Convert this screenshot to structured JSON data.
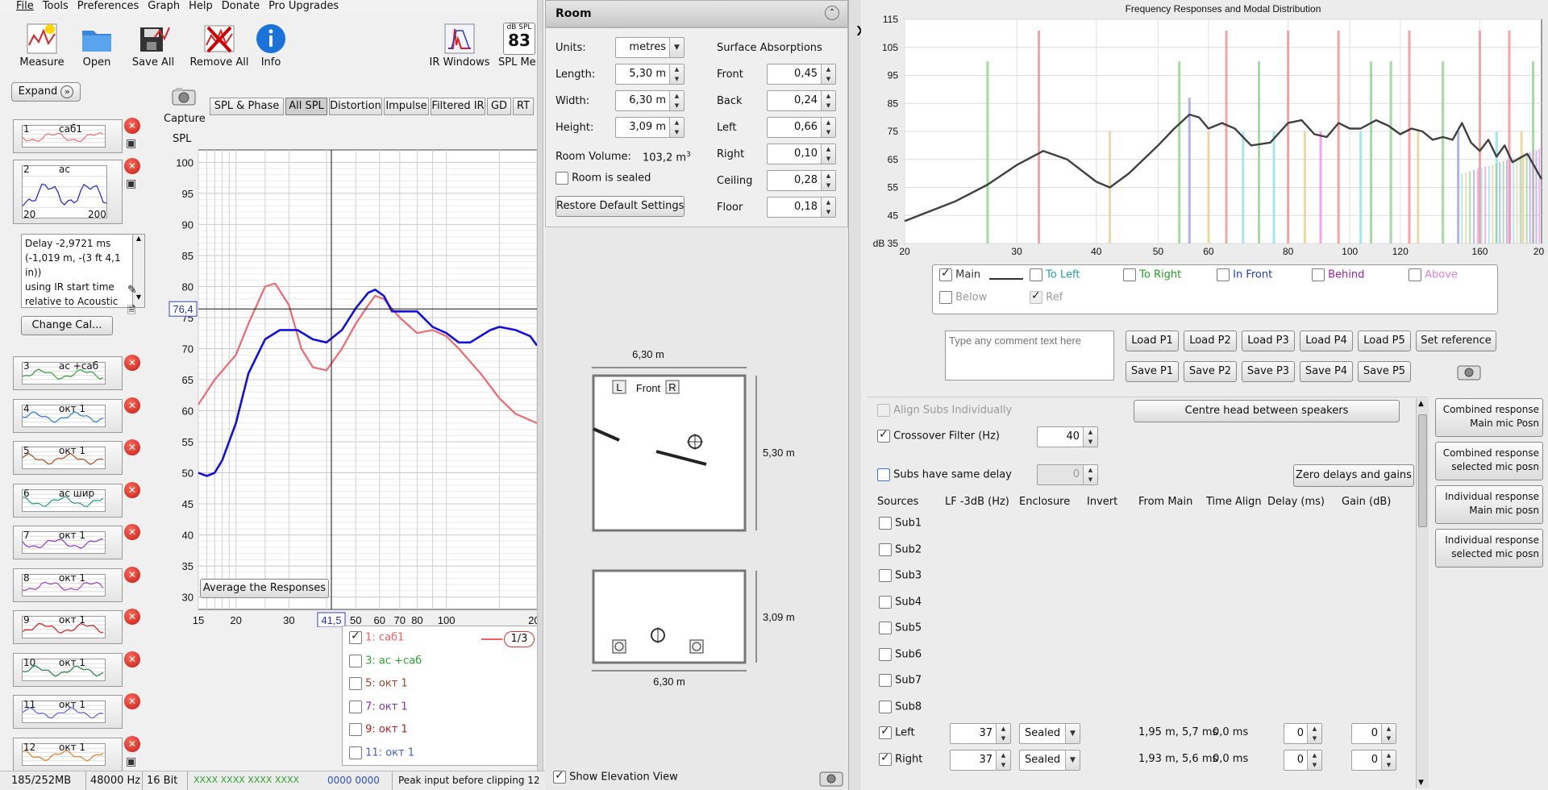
{
  "menu": [
    "File",
    "Tools",
    "Preferences",
    "Graph",
    "Help",
    "Donate",
    "Pro Upgrades"
  ],
  "toolbar": {
    "measure": "Measure",
    "open": "Open",
    "save_all": "Save All",
    "remove_all": "Remove All",
    "info": "Info",
    "ir_windows": "IR Windows",
    "spl_meter": "SPL Me",
    "spl_unit": "dB SPL",
    "spl_value": "83"
  },
  "sidebar": {
    "expand": "Expand",
    "items": [
      {
        "num": "1",
        "name": "саб1"
      },
      {
        "num": "2",
        "name": "ac"
      },
      {
        "num": "3",
        "name": "ac +саб"
      },
      {
        "num": "4",
        "name": "окт 1"
      },
      {
        "num": "5",
        "name": "окт 1"
      },
      {
        "num": "6",
        "name": "ac шир"
      },
      {
        "num": "7",
        "name": "окт 1"
      },
      {
        "num": "8",
        "name": "окт 1"
      },
      {
        "num": "9",
        "name": "окт 1"
      },
      {
        "num": "10",
        "name": "окт 1"
      },
      {
        "num": "11",
        "name": "окт 1"
      },
      {
        "num": "12",
        "name": "окт 1"
      }
    ],
    "thumb_axis_min": "20",
    "thumb_axis_max": "200",
    "notes": [
      "Delay -2,9721 ms",
      "(-1,019 m, -(3 ft 4,1",
      "in))",
      "using IR start time",
      "relative to Acoustic"
    ],
    "change_cal": "Change Cal..."
  },
  "graph": {
    "capture": "Capture",
    "tabs": [
      "SPL & Phase",
      "All SPL",
      "Distortion",
      "Impulse",
      "Filtered IR",
      "GD",
      "RT"
    ],
    "ylabel": "SPL",
    "cursor_y": "76,4",
    "cursor_x": "41,5",
    "average": "Average the Responses",
    "legend": [
      {
        "label": "1: саб1",
        "color": "#f06060",
        "checked": true
      },
      {
        "label": "3: ac +саб",
        "color": "#30a030",
        "checked": false
      },
      {
        "label": "5: окт 1",
        "color": "#b04020",
        "checked": false
      },
      {
        "label": "7: окт 1",
        "color": "#8030c0",
        "checked": false
      },
      {
        "label": "9: окт 1",
        "color": "#c02020",
        "checked": false
      },
      {
        "label": "11: окт 1",
        "color": "#4060d0",
        "checked": false
      }
    ],
    "smoothing": "1/3"
  },
  "chart_data": [
    {
      "type": "line",
      "ylabel": "SPL",
      "ylim": [
        28,
        102
      ],
      "x_ticks": [
        "15",
        "20",
        "30",
        "50",
        "60",
        "70",
        "80",
        "100",
        "200"
      ],
      "y_ticks": [
        "100",
        "95",
        "90",
        "85",
        "80",
        "75",
        "70",
        "65",
        "60",
        "55",
        "50",
        "45",
        "40",
        "35",
        "30"
      ],
      "series": [
        {
          "color": "#f06870",
          "points": [
            [
              15,
              61
            ],
            [
              17,
              65
            ],
            [
              20,
              69
            ],
            [
              22,
              74
            ],
            [
              25,
              80
            ],
            [
              27,
              80.5
            ],
            [
              30,
              77
            ],
            [
              33,
              70
            ],
            [
              36,
              67
            ],
            [
              40,
              66.5
            ],
            [
              45,
              70
            ],
            [
              50,
              74
            ],
            [
              55,
              77
            ],
            [
              58,
              78.5
            ],
            [
              62,
              78
            ],
            [
              70,
              75
            ],
            [
              80,
              72.5
            ],
            [
              90,
              73
            ],
            [
              100,
              72
            ],
            [
              110,
              70
            ],
            [
              130,
              66
            ],
            [
              150,
              62
            ],
            [
              170,
              59.5
            ],
            [
              200,
              58
            ]
          ]
        },
        {
          "color": "#1010e0",
          "points": [
            [
              15,
              50
            ],
            [
              16,
              49.5
            ],
            [
              17,
              50
            ],
            [
              18,
              52
            ],
            [
              20,
              58
            ],
            [
              22,
              66
            ],
            [
              25,
              71.5
            ],
            [
              28,
              73
            ],
            [
              32,
              73
            ],
            [
              36,
              71.5
            ],
            [
              40,
              71
            ],
            [
              45,
              73
            ],
            [
              50,
              76.5
            ],
            [
              55,
              79
            ],
            [
              58,
              79.5
            ],
            [
              62,
              78.5
            ],
            [
              66,
              76
            ],
            [
              70,
              76
            ],
            [
              80,
              76
            ],
            [
              90,
              73.5
            ],
            [
              100,
              72.5
            ],
            [
              110,
              71
            ],
            [
              120,
              71
            ],
            [
              140,
              73
            ],
            [
              150,
              73.5
            ],
            [
              170,
              73
            ],
            [
              190,
              72
            ],
            [
              200,
              70.5
            ]
          ]
        }
      ]
    },
    {
      "type": "line",
      "title": "Frequency Responses and Modal Distribution",
      "ylabel": "dB",
      "ylim": [
        35,
        115
      ],
      "xlim": [
        20,
        200
      ],
      "x_ticks": [
        "20",
        "30",
        "40",
        "50",
        "60",
        "80",
        "100",
        "120",
        "160",
        "20"
      ],
      "y_ticks": [
        "115",
        "105",
        "95",
        "85",
        "75",
        "65",
        "55",
        "45",
        "35"
      ],
      "series": [
        {
          "name": "Main",
          "color": "#404040",
          "points": [
            [
              20,
              43
            ],
            [
              24,
              50
            ],
            [
              27,
              56
            ],
            [
              30,
              63
            ],
            [
              33,
              68
            ],
            [
              36,
              65
            ],
            [
              40,
              57
            ],
            [
              42,
              55
            ],
            [
              45,
              60
            ],
            [
              50,
              70
            ],
            [
              53,
              76
            ],
            [
              56,
              81
            ],
            [
              58,
              80
            ],
            [
              60,
              76
            ],
            [
              63,
              78
            ],
            [
              66,
              76
            ],
            [
              70,
              70
            ],
            [
              75,
              71
            ],
            [
              80,
              78
            ],
            [
              84,
              79
            ],
            [
              88,
              74
            ],
            [
              92,
              73
            ],
            [
              96,
              78
            ],
            [
              100,
              76
            ],
            [
              104,
              76
            ],
            [
              110,
              79
            ],
            [
              115,
              77
            ],
            [
              120,
              74
            ],
            [
              125,
              76
            ],
            [
              130,
              75
            ],
            [
              135,
              72
            ],
            [
              140,
              73
            ],
            [
              145,
              72
            ],
            [
              150,
              78
            ],
            [
              155,
              71
            ],
            [
              160,
              68
            ],
            [
              165,
              72
            ],
            [
              170,
              66
            ],
            [
              175,
              70
            ],
            [
              180,
              64
            ],
            [
              190,
              67
            ],
            [
              200,
              58
            ]
          ]
        }
      ],
      "mode_bars": [
        {
          "freq": 27,
          "height": 100,
          "color": "#8fcf8f"
        },
        {
          "freq": 32.5,
          "height": 111,
          "color": "#f08f8f"
        },
        {
          "freq": 42,
          "height": 75,
          "color": "#e6cf8f"
        },
        {
          "freq": 54,
          "height": 100,
          "color": "#8fcf8f"
        },
        {
          "freq": 56,
          "height": 87,
          "color": "#9f9fe6"
        },
        {
          "freq": 60,
          "height": 75,
          "color": "#e6cf8f"
        },
        {
          "freq": 64,
          "height": 111,
          "color": "#f08f8f"
        },
        {
          "freq": 68,
          "height": 75,
          "color": "#8fe0e6"
        },
        {
          "freq": 72,
          "height": 100,
          "color": "#8fcf8f"
        },
        {
          "freq": 76,
          "height": 75,
          "color": "#8fe0e6"
        },
        {
          "freq": 80,
          "height": 111,
          "color": "#f08f8f"
        },
        {
          "freq": 85,
          "height": 75,
          "color": "#e6cf8f"
        },
        {
          "freq": 90,
          "height": 75,
          "color": "#f08fe6"
        },
        {
          "freq": 96,
          "height": 111,
          "color": "#f08f8f"
        },
        {
          "freq": 104,
          "height": 75,
          "color": "#8fe0e6"
        },
        {
          "freq": 108,
          "height": 100,
          "color": "#8fcf8f"
        },
        {
          "freq": 116,
          "height": 100,
          "color": "#8fcf8f"
        },
        {
          "freq": 124,
          "height": 111,
          "color": "#f08f8f"
        },
        {
          "freq": 128,
          "height": 75,
          "color": "#e6cf8f"
        },
        {
          "freq": 140,
          "height": 100,
          "color": "#8fcf8f"
        },
        {
          "freq": 148,
          "height": 75,
          "color": "#9f9fe6"
        },
        {
          "freq": 160,
          "height": 111,
          "color": "#f08f8f"
        },
        {
          "freq": 170,
          "height": 75,
          "color": "#8fe0e6"
        },
        {
          "freq": 178,
          "height": 111,
          "color": "#f08f8f"
        },
        {
          "freq": 186,
          "height": 75,
          "color": "#e6cf8f"
        },
        {
          "freq": 194,
          "height": 100,
          "color": "#8fcf8f"
        }
      ]
    }
  ],
  "room": {
    "title": "Room",
    "units_label": "Units:",
    "units": "metres",
    "length_label": "Length:",
    "length": "5,30 m",
    "width_label": "Width:",
    "width": "6,30 m",
    "height_label": "Height:",
    "height": "3,09 m",
    "volume_label": "Room Volume:",
    "volume": "103,2 m",
    "volume_unit_sup": "3",
    "sealed_label": "Room is sealed",
    "restore": "Restore Default Settings",
    "surface_label": "Surface Absorptions",
    "surfaces": [
      {
        "name": "Front",
        "value": "0,45"
      },
      {
        "name": "Back",
        "value": "0,24"
      },
      {
        "name": "Left",
        "value": "0,66"
      },
      {
        "name": "Right",
        "value": "0,10"
      },
      {
        "name": "Ceiling",
        "value": "0,28"
      },
      {
        "name": "Floor",
        "value": "0,18"
      }
    ],
    "plan_width": "6,30 m",
    "plan_depth": "5,30 m",
    "plan_front": "Front",
    "plan_L": "L",
    "plan_R": "R",
    "elev_height": "3,09 m",
    "elev_width": "6,30 m",
    "show_elevation": "Show Elevation View"
  },
  "modal": {
    "legend": [
      {
        "label": "Main",
        "color": "#333333",
        "checked": true
      },
      {
        "label": "To Left",
        "color": "#20a0a0",
        "checked": false
      },
      {
        "label": "To Right",
        "color": "#20a020",
        "checked": false
      },
      {
        "label": "In Front",
        "color": "#2040c0",
        "checked": false
      },
      {
        "label": "Behind",
        "color": "#a020a0",
        "checked": false
      },
      {
        "label": "Above",
        "color": "#e080e0",
        "checked": false
      },
      {
        "label": "Below",
        "color": "#999999",
        "checked": false
      },
      {
        "label": "Ref",
        "color": "#999999",
        "checked": true
      }
    ],
    "comment_placeholder": "Type any comment text here",
    "load": [
      "Load P1",
      "Load P2",
      "Load P3",
      "Load P4",
      "Load P5"
    ],
    "save": [
      "Save P1",
      "Save P2",
      "Save P3",
      "Save P4",
      "Save P5"
    ],
    "set_reference": "Set reference"
  },
  "subs": {
    "align_subs": "Align Subs Individually",
    "centre_head": "Centre head between speakers",
    "crossover_label": "Crossover Filter (Hz)",
    "crossover": "40",
    "same_delay": "Subs have same delay",
    "same_delay_value": "0",
    "zero_btn": "Zero delays and gains",
    "headers": [
      "Sources",
      "LF -3dB (Hz)",
      "Enclosure",
      "Invert",
      "From Main",
      "Time Align",
      "Delay (ms)",
      "Gain (dB)"
    ],
    "subs": [
      "Sub1",
      "Sub2",
      "Sub3",
      "Sub4",
      "Sub5",
      "Sub6",
      "Sub7",
      "Sub8"
    ],
    "mains": [
      {
        "name": "Left",
        "lf": "37",
        "enclosure": "Sealed",
        "from_main": "1,95 m, 5,7 ms",
        "time_align": "0,0 ms",
        "delay": "0",
        "gain": "0"
      },
      {
        "name": "Right",
        "lf": "37",
        "enclosure": "Sealed",
        "from_main": "1,93 m, 5,6 ms",
        "time_align": "0,0 ms",
        "delay": "0",
        "gain": "0"
      }
    ],
    "side_buttons": [
      [
        "Combined response",
        "Main mic Posn"
      ],
      [
        "Combined response",
        "selected mic posn"
      ],
      [
        "Individual response",
        "Main mic posn"
      ],
      [
        "Individual response",
        "selected mic posn"
      ]
    ]
  },
  "status": {
    "memory": "185/252MB",
    "rate": "48000 Hz",
    "bits": "16 Bit",
    "meter_green": "XXXX XXXX   XXXX XXXX",
    "meter_blue": "0000 0000",
    "peak": "Peak input before clipping 12"
  }
}
